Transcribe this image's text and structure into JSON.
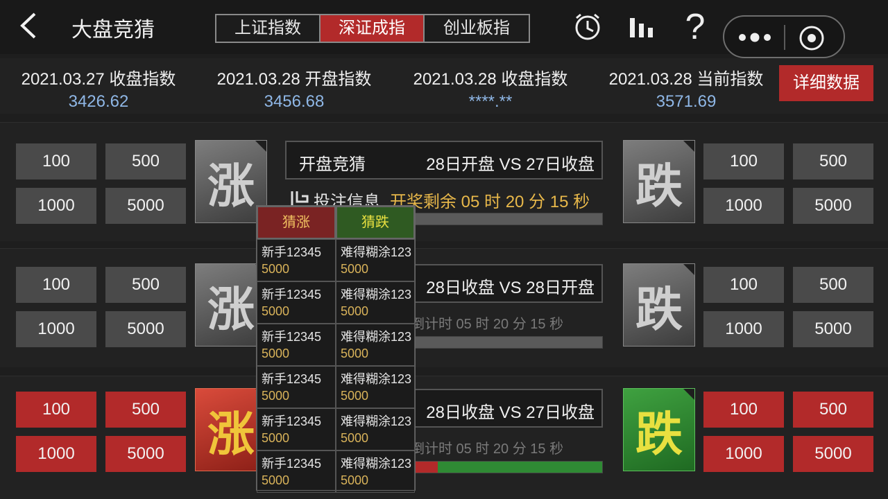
{
  "header": {
    "title": "大盘竞猜",
    "tabs": [
      {
        "label": "上证指数",
        "active": false
      },
      {
        "label": "深证成指",
        "active": true
      },
      {
        "label": "创业板指",
        "active": false
      }
    ],
    "icons": [
      "clock-icon",
      "bar-chart-icon",
      "help-icon",
      "more-icon",
      "close-target-icon"
    ]
  },
  "stats": [
    {
      "label": "2021.03.27 收盘指数",
      "value": "3426.62"
    },
    {
      "label": "2021.03.28 开盘指数",
      "value": "3456.68"
    },
    {
      "label": "2021.03.28 收盘指数",
      "value": "****.**"
    },
    {
      "label": "2021.03.28 当前指数",
      "value": "3571.69"
    }
  ],
  "detail_button": "详细数据",
  "sections": [
    {
      "left_bets": [
        "100",
        "500",
        "1000",
        "5000"
      ],
      "right_bets": [
        "100",
        "500",
        "1000",
        "5000"
      ],
      "rise_char": "涨",
      "fall_char": "跌",
      "match_left": "开盘竞猜",
      "match_right": "28日开盘 VS 27日收盘",
      "info_label": "投注信息",
      "countdown": "开奖剩余 05 时 20 分 15 秒"
    },
    {
      "left_bets": [
        "100",
        "500",
        "1000",
        "5000"
      ],
      "right_bets": [
        "100",
        "500",
        "1000",
        "5000"
      ],
      "rise_char": "涨",
      "fall_char": "跌",
      "match_right": "28日收盘 VS 28日开盘",
      "countdown": "倒计时 05 时  20 分  15 秒"
    },
    {
      "left_bets": [
        "100",
        "500",
        "1000",
        "5000"
      ],
      "right_bets": [
        "100",
        "500",
        "1000",
        "5000"
      ],
      "rise_char": "涨",
      "fall_char": "跌",
      "match_right": "28日收盘 VS 27日收盘",
      "countdown": "倒计时 05 时  20 分  15 秒"
    }
  ],
  "popup": {
    "rise_header": "猜涨",
    "fall_header": "猜跌",
    "rows": [
      {
        "rise_name": "新手12345",
        "rise_amount": "5000",
        "fall_name": "难得糊涂123",
        "fall_amount": "5000"
      },
      {
        "rise_name": "新手12345",
        "rise_amount": "5000",
        "fall_name": "难得糊涂123",
        "fall_amount": "5000"
      },
      {
        "rise_name": "新手12345",
        "rise_amount": "5000",
        "fall_name": "难得糊涂123",
        "fall_amount": "5000"
      },
      {
        "rise_name": "新手12345",
        "rise_amount": "5000",
        "fall_name": "难得糊涂123",
        "fall_amount": "5000"
      },
      {
        "rise_name": "新手12345",
        "rise_amount": "5000",
        "fall_name": "难得糊涂123",
        "fall_amount": "5000"
      },
      {
        "rise_name": "新手12345",
        "rise_amount": "5000",
        "fall_name": "难得糊涂123",
        "fall_amount": "5000"
      }
    ]
  },
  "colors": {
    "accent_red": "#b22a2a",
    "accent_green": "#2f8a34",
    "value_blue": "#8fb7e6",
    "countdown_gold": "#e8b84a"
  }
}
